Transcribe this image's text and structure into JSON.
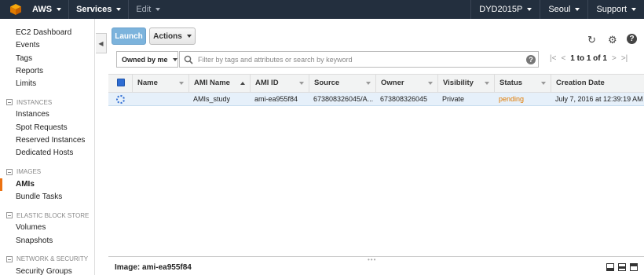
{
  "topbar": {
    "brand": "AWS",
    "services": "Services",
    "edit": "Edit",
    "account": "DYD2015P",
    "region": "Seoul",
    "support": "Support"
  },
  "sidebar": {
    "items": [
      {
        "label": "EC2 Dashboard"
      },
      {
        "label": "Events"
      },
      {
        "label": "Tags"
      },
      {
        "label": "Reports"
      },
      {
        "label": "Limits"
      }
    ],
    "sections": [
      {
        "title": "INSTANCES",
        "items": [
          "Instances",
          "Spot Requests",
          "Reserved Instances",
          "Dedicated Hosts"
        ]
      },
      {
        "title": "IMAGES",
        "items": [
          "AMIs",
          "Bundle Tasks"
        ]
      },
      {
        "title": "ELASTIC BLOCK STORE",
        "items": [
          "Volumes",
          "Snapshots"
        ]
      },
      {
        "title": "NETWORK & SECURITY",
        "items": [
          "Security Groups"
        ]
      }
    ],
    "active": "AMIs"
  },
  "toolbar": {
    "launch": "Launch",
    "actions": "Actions"
  },
  "filter": {
    "owned": "Owned by me",
    "search_placeholder": "Filter by tags and attributes or search by keyword",
    "pager": "1 to 1 of 1"
  },
  "table": {
    "columns": [
      "Name",
      "AMI Name",
      "AMI ID",
      "Source",
      "Owner",
      "Visibility",
      "Status",
      "Creation Date"
    ],
    "rows": [
      {
        "name": "",
        "ami_name": "AMIs_study",
        "ami_id": "ami-ea955f84",
        "source": "673808326045/A...",
        "owner": "673808326045",
        "visibility": "Private",
        "status": "pending",
        "creation_date": "July 7, 2016 at 12:39:19 AM"
      }
    ]
  },
  "detail": {
    "title": "Image: ami-ea955f84"
  },
  "colors": {
    "topbar": "#232f3e",
    "accent": "#ec7211",
    "launch": "#7cb3dc",
    "selected_row": "#e6f0fa",
    "pending": "#e07b00"
  }
}
